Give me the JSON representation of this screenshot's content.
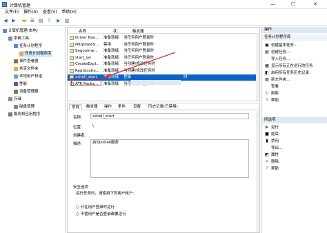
{
  "window": {
    "title": "计算机管理",
    "minimize": "—",
    "maximize": "☐",
    "close": "✕"
  },
  "menu": [
    "文件(F)",
    "操作(A)",
    "查看(V)",
    "帮助(H)"
  ],
  "toolbar_icons": [
    "back-arrow-icon",
    "forward-arrow-icon",
    "folder-icon",
    "list-icon",
    "properties-icon",
    "help-icon",
    "run-icon",
    "panel-icon"
  ],
  "tree": [
    {
      "label": "计算机管理(本地)",
      "indent": 0,
      "icon_color": "#5b8fc8"
    },
    {
      "label": "系统工具",
      "indent": 1,
      "icon_color": "#8a8a8a"
    },
    {
      "label": "任务计划程序",
      "indent": 2,
      "icon_color": "#4a90d9"
    },
    {
      "label": "任务计划程序库",
      "indent": 3,
      "icon_color": "#e0b040",
      "selected": true
    },
    {
      "label": "事件查看器",
      "indent": 2,
      "icon_color": "#9a6a3a"
    },
    {
      "label": "共享文件夹",
      "indent": 2,
      "icon_color": "#e0b040"
    },
    {
      "label": "本地用户和组",
      "indent": 2,
      "icon_color": "#6aa0d0"
    },
    {
      "label": "性能",
      "indent": 2,
      "icon_color": "#7a4aa0"
    },
    {
      "label": "设备管理器",
      "indent": 2,
      "icon_color": "#5a8a5a"
    },
    {
      "label": "存储",
      "indent": 1,
      "icon_color": "#8a8a8a"
    },
    {
      "label": "磁盘管理",
      "indent": 2,
      "icon_color": "#5b8fc8"
    },
    {
      "label": "服务和应用程序",
      "indent": 1,
      "icon_color": "#7a7a7a"
    }
  ],
  "task_list": {
    "headers": [
      "名称",
      "状...",
      "触发器"
    ],
    "rows": [
      {
        "name": "Driver Boo...",
        "status": "准备就绪",
        "trigger": "当任何用户登录时"
      },
      {
        "name": "NIUpdateS...",
        "status": "禁用",
        "trigger": "当任何用户登录时"
      },
      {
        "name": "Sogoulme...",
        "status": "准备就绪",
        "trigger": "当任何用户登录时"
      },
      {
        "name": "start_ssr",
        "status": "准备就绪",
        "trigger": "当任何用户登录时"
      },
      {
        "name": "CreateExpl...",
        "status": "准备就绪",
        "trigger": "当创建/修改任务时"
      },
      {
        "name": "Registratio...",
        "status": "准备就绪",
        "trigger": "当创建/修改任务时"
      },
      {
        "name": "xshell_start",
        "status": "准备就绪",
        "trigger": "登录",
        "trigger_suffix": "时",
        "selected": true
      },
      {
        "name": "ATK Packa...",
        "status": "准备就绪",
        "trigger": "当任何用户登录时"
      },
      {
        "name": "",
        "status": "",
        "trigger": ""
      },
      {
        "name": "",
        "status": "",
        "trigger": ""
      }
    ]
  },
  "detail_tabs": [
    "常规",
    "触发器",
    "操作",
    "条件",
    "设置",
    "历史记录(已禁用)"
  ],
  "general": {
    "name_label": "名称:",
    "name_value": "xshell_start",
    "location_label": "位置:",
    "location_value": "\\",
    "author_label": "创建者:",
    "author_value": "",
    "desc_label": "描述:",
    "desc_value": "启动xshell服务",
    "security_title": "安全选项",
    "run_as_label": "运行任务时，请使用下列用户帐户:",
    "run_as_value": "",
    "option_only_logged_on": "只在用户登录时运行",
    "option_whether_logged": "不管用户是否登录都要运行"
  },
  "actions": {
    "section1": "操作",
    "section1_sub": "任务计划程序库",
    "items1": [
      {
        "icon": "create-basic-task-icon",
        "glyph": "▣",
        "label": "创建基本任务..."
      },
      {
        "icon": "create-task-icon",
        "glyph": "▤",
        "label": "创建任务..."
      },
      {
        "icon": "import-task-icon",
        "glyph": "",
        "label": "导入任务..."
      },
      {
        "icon": "show-running-icon",
        "glyph": "▦",
        "label": "显示所有正在运行的任务"
      },
      {
        "icon": "enable-history-icon",
        "glyph": "◧",
        "label": "启用所有任务历史记录"
      },
      {
        "icon": "new-folder-icon",
        "glyph": "▧",
        "label": "新文件夹..."
      },
      {
        "icon": "view-icon",
        "glyph": "",
        "label": "查看"
      },
      {
        "icon": "refresh-icon",
        "glyph": "↻",
        "label": "刷新"
      },
      {
        "icon": "help-icon",
        "glyph": "?",
        "label": "帮助"
      }
    ],
    "section2": "所选项",
    "items2": [
      {
        "icon": "run-icon",
        "glyph": "▶",
        "label": "运行"
      },
      {
        "icon": "end-icon",
        "glyph": "■",
        "label": "结束"
      },
      {
        "icon": "disable-icon",
        "glyph": "▮",
        "label": "禁用"
      },
      {
        "icon": "export-icon",
        "glyph": "",
        "label": "导出..."
      },
      {
        "icon": "properties-icon",
        "glyph": "◩",
        "label": "属性"
      },
      {
        "icon": "delete-icon",
        "glyph": "✕",
        "label": "删除"
      },
      {
        "icon": "help-icon",
        "glyph": "?",
        "label": "帮助"
      }
    ]
  },
  "colors": {
    "selection": "#0a64c8",
    "highlight_box": "#e03030",
    "tree_selection": "#cce8ff"
  }
}
